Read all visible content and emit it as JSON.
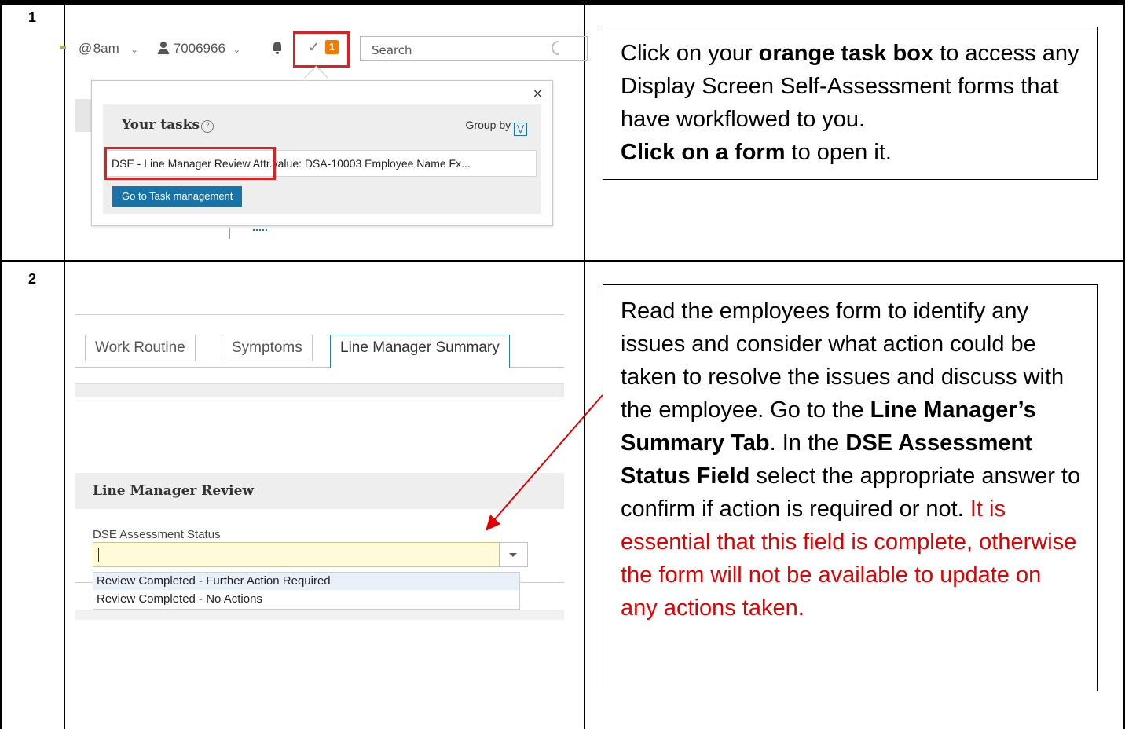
{
  "rows": [
    {
      "number": "1",
      "screenshot": {
        "header": {
          "shift": "8am",
          "user_id": "7006966",
          "task_count": "1",
          "search_placeholder": "Search"
        },
        "tasks_popup": {
          "close": "×",
          "title": "Your tasks",
          "help": "?",
          "group_by": "Group by",
          "task_item": "DSE - Line Manager Review Attr.value: DSA-10003 Employee Name Fx...",
          "button": "Go to Task management"
        }
      },
      "instruction": {
        "p1": "Click on your ",
        "p1_bold": "orange task box",
        "p2": " to access any Display Screen Self-Assessment forms that have workflowed to you.",
        "p3_bold": "Click on a form",
        "p3": " to open it."
      }
    },
    {
      "number": "2",
      "screenshot": {
        "tabs": [
          "Work Routine",
          "Symptoms",
          "Line Manager Summary"
        ],
        "section_title": "Line Manager Review",
        "field_label": "DSE Assessment Status",
        "options": [
          "Review Completed - Further Action Required",
          "Review Completed - No Actions"
        ]
      },
      "instruction": {
        "t1": "Read the employees form to identify any issues and consider what action could be taken to resolve the issues and discuss with the employee.  Go to the ",
        "b1": "Line Manager’s Summary Tab",
        "t2": ".  In the ",
        "b2": "DSE Assessment Status Field",
        "t3": " select the appropriate answer to confirm if action is required or not.  ",
        "red": "It is essential that this field is complete, otherwise the form will not be available to update on any actions taken."
      }
    }
  ],
  "colors": {
    "highlight_red": "#e02020",
    "task_badge_orange": "#f07d00",
    "button_blue": "#1a73a8",
    "warning_text_red": "#e00000"
  }
}
